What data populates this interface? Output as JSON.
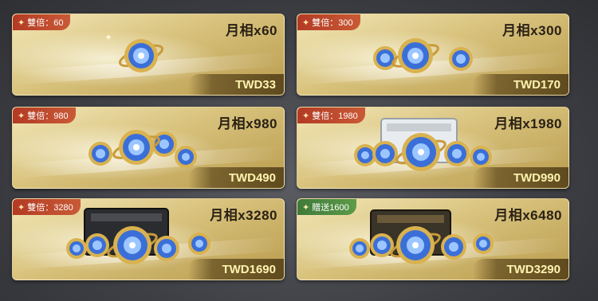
{
  "colors": {
    "badge_red": "#b33a24",
    "badge_green": "#3f7a3a",
    "price_text": "#fff3b0",
    "card_gold": "#d8c27c",
    "title_text": "#2a2115"
  },
  "packs": [
    {
      "badge_icon": "star-icon",
      "badge_text": "雙倍：60",
      "badge_color": "red",
      "title": "月相x60",
      "price": "TWD33"
    },
    {
      "badge_icon": "star-icon",
      "badge_text": "雙倍：300",
      "badge_color": "red",
      "title": "月相x300",
      "price": "TWD170"
    },
    {
      "badge_icon": "star-icon",
      "badge_text": "雙倍：980",
      "badge_color": "red",
      "title": "月相x980",
      "price": "TWD490"
    },
    {
      "badge_icon": "star-icon",
      "badge_text": "雙倍：1980",
      "badge_color": "red",
      "title": "月相x1980",
      "price": "TWD990"
    },
    {
      "badge_icon": "star-icon",
      "badge_text": "雙倍：3280",
      "badge_color": "red",
      "title": "月相x3280",
      "price": "TWD1690"
    },
    {
      "badge_icon": "star-icon",
      "badge_text": "贈送1600",
      "badge_color": "green",
      "title": "月相x6480",
      "price": "TWD3290"
    }
  ]
}
